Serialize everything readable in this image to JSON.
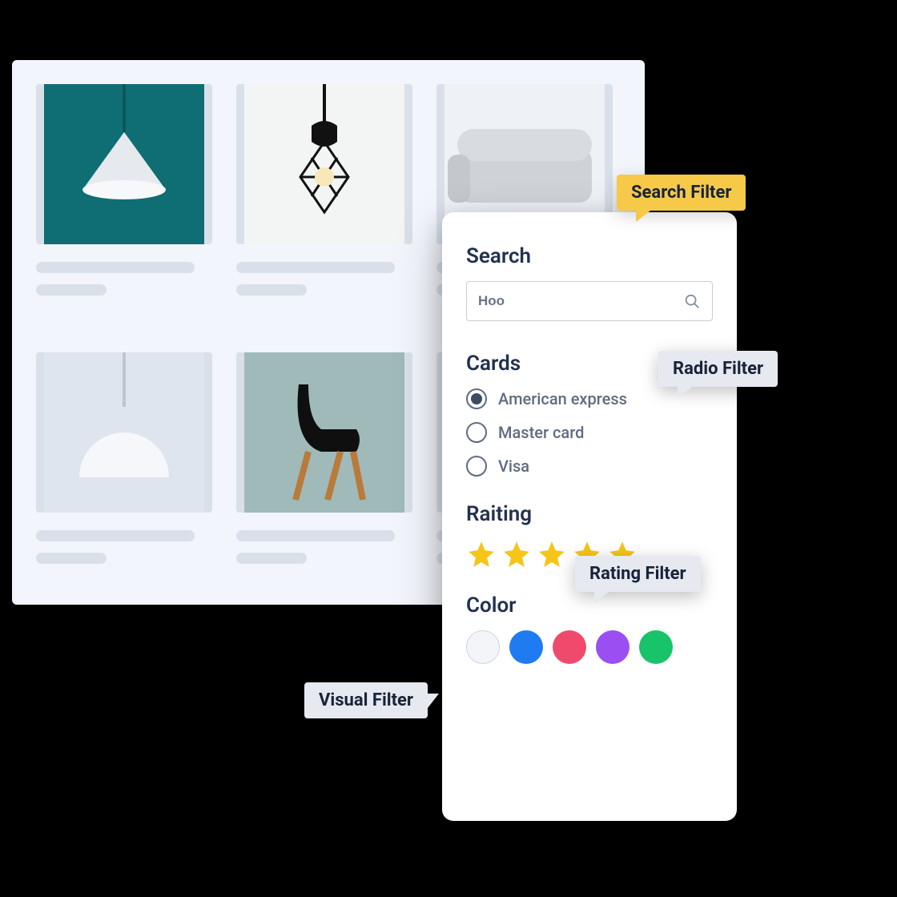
{
  "callouts": {
    "search": "Search Filter",
    "radio": "Radio Filter",
    "rating": "Rating Filter",
    "visual": "Visual Filter"
  },
  "filters": {
    "search": {
      "title": "Search",
      "value": "Hoo"
    },
    "cards": {
      "title": "Cards",
      "options": [
        "American express",
        "Master card",
        "Visa"
      ],
      "selected_index": 0
    },
    "rating": {
      "title": "Raiting",
      "value": 5,
      "max": 5
    },
    "color": {
      "title": "Color",
      "swatches": [
        "#f3f5f9",
        "#1f7bf2",
        "#ef4a6b",
        "#9b4ef2",
        "#18c369"
      ]
    }
  },
  "products": [
    {
      "img": "pendant-teal"
    },
    {
      "img": "cage-lamp"
    },
    {
      "img": "sofa"
    },
    {
      "img": "dome-lamp"
    },
    {
      "img": "chair"
    },
    {
      "img": "placeholder"
    }
  ]
}
